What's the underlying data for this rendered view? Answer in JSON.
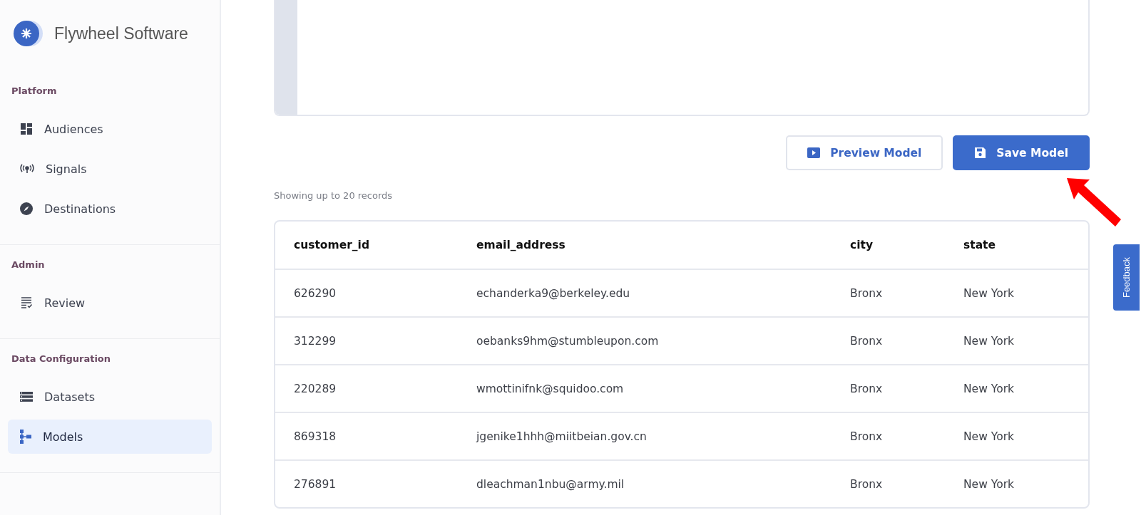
{
  "brand": {
    "name": "Flywheel Software"
  },
  "sidebar": {
    "sections": [
      {
        "title": "Platform",
        "items": [
          {
            "label": "Audiences",
            "selected": false
          },
          {
            "label": "Signals",
            "selected": false
          },
          {
            "label": "Destinations",
            "selected": false
          }
        ]
      },
      {
        "title": "Admin",
        "items": [
          {
            "label": "Review",
            "selected": false
          }
        ]
      },
      {
        "title": "Data Configuration",
        "items": [
          {
            "label": "Datasets",
            "selected": false
          },
          {
            "label": "Models",
            "selected": true
          }
        ]
      }
    ]
  },
  "actions": [
    {
      "label": "Preview Model",
      "kind": "secondary"
    },
    {
      "label": "Save Model",
      "kind": "primary"
    }
  ],
  "records_note": "Showing up to 20 records",
  "table": {
    "columns": [
      "customer_id",
      "email_address",
      "city",
      "state"
    ],
    "rows": [
      [
        "626290",
        "echanderka9@berkeley.edu",
        "Bronx",
        "New York"
      ],
      [
        "312299",
        "oebanks9hm@stumbleupon.com",
        "Bronx",
        "New York"
      ],
      [
        "220289",
        "wmottinifnk@squidoo.com",
        "Bronx",
        "New York"
      ],
      [
        "869318",
        "jgenike1hhh@miitbeian.gov.cn",
        "Bronx",
        "New York"
      ],
      [
        "276891",
        "dleachman1nbu@army.mil",
        "Bronx",
        "New York"
      ]
    ]
  },
  "feedback": {
    "label": "Feedback"
  }
}
